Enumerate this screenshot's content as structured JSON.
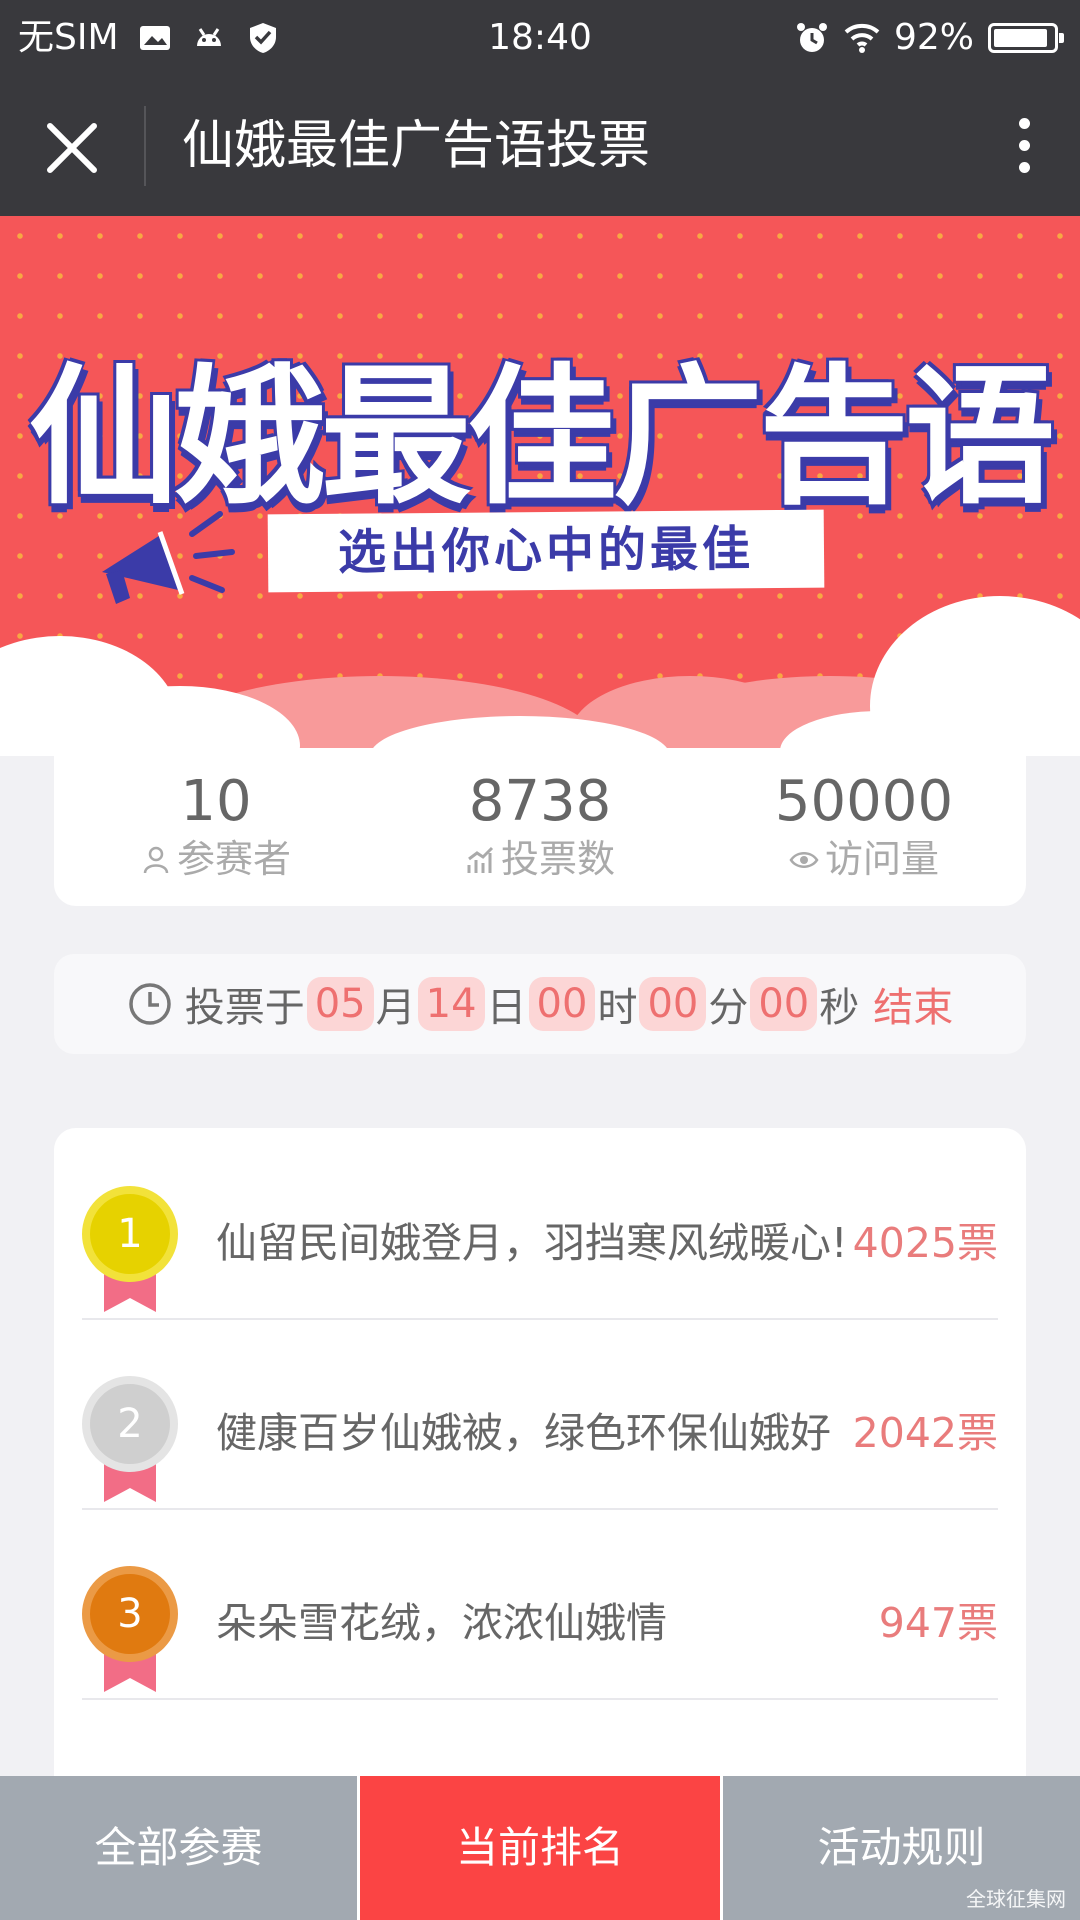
{
  "status_bar": {
    "carrier": "无SIM",
    "time": "18:40",
    "battery_percent": "92%",
    "battery_level": 0.92,
    "icons": [
      "image-icon",
      "android-icon",
      "shield-icon",
      "alarm-icon",
      "wifi-icon",
      "battery-icon"
    ]
  },
  "nav": {
    "title": "仙娥最佳广告语投票",
    "close_icon": "close-icon",
    "more_icon": "more-vertical-icon"
  },
  "banner": {
    "title": "仙娥最佳广告语",
    "tagline": "选出你心中的最佳",
    "colors": {
      "background": "#f55658",
      "title_outline": "#3b3ba8",
      "dots": "#f7a843"
    }
  },
  "stats": [
    {
      "value": "10",
      "label": "参赛者",
      "icon": "user-icon"
    },
    {
      "value": "8738",
      "label": "投票数",
      "icon": "chart-icon"
    },
    {
      "value": "50000",
      "label": "访问量",
      "icon": "eye-icon"
    }
  ],
  "countdown": {
    "prefix": "投票于",
    "month": "05",
    "month_unit": "月",
    "day": "14",
    "day_unit": "日",
    "hour": "00",
    "hour_unit": "时",
    "minute": "00",
    "minute_unit": "分",
    "second": "00",
    "second_unit": "秒",
    "suffix": "结束",
    "icon": "clock-icon"
  },
  "ranking": [
    {
      "rank": "1",
      "text": "仙留民间娥登月，羽挡寒风绒暖心!",
      "votes": "4025票",
      "medal_color": "#e6d200",
      "medal_border": "#f2e23a"
    },
    {
      "rank": "2",
      "text": "健康百岁仙娥被，绿色环保仙娥好",
      "votes": "2042票",
      "medal_color": "#cfcfcf",
      "medal_border": "#e4e4e4"
    },
    {
      "rank": "3",
      "text": "朵朵雪花绒，浓浓仙娥情",
      "votes": "947票",
      "medal_color": "#e07a10",
      "medal_border": "#eb9a45"
    }
  ],
  "tabs": [
    {
      "label": "全部参赛",
      "active": false
    },
    {
      "label": "当前排名",
      "active": true
    },
    {
      "label": "活动规则",
      "active": false
    }
  ],
  "watermark": "全球征集网",
  "colors": {
    "accent": "#fb4444",
    "tab_inactive": "#a2a9b1",
    "vote_text": "#e97c7c",
    "countdown_box": "#fcd6d6"
  }
}
